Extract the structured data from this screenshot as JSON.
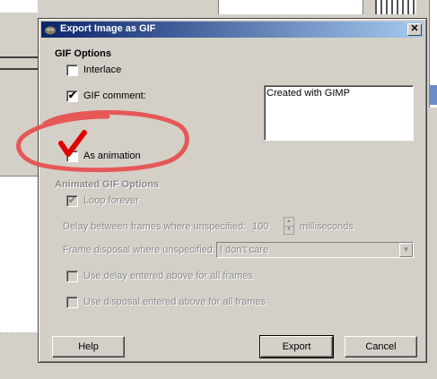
{
  "dialog": {
    "title": "Export Image as GIF",
    "close_label": "✕"
  },
  "gif_options": {
    "heading": "GIF Options",
    "interlace_label": "Interlace",
    "interlace_checked": false,
    "comment_label": "GIF comment:",
    "comment_checked": true,
    "comment_value": "Created with GIMP",
    "animation_label": "As animation",
    "animation_checked": false
  },
  "animated_options": {
    "heading": "Animated GIF Options",
    "loop_label": "Loop forever",
    "loop_checked": true,
    "delay_label": "Delay between frames where unspecified:",
    "delay_value": "100",
    "delay_unit": "milliseconds",
    "disposal_label": "Frame disposal where unspecified:",
    "disposal_value": "I don't care",
    "use_delay_label": "Use delay entered above for all frames",
    "use_disposal_label": "Use disposal entered above for all frames"
  },
  "buttons": {
    "help": "Help",
    "export": "Export",
    "cancel": "Cancel"
  }
}
